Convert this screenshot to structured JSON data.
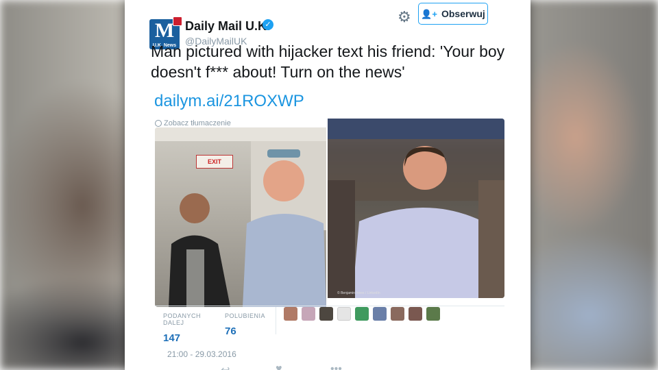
{
  "tweet": {
    "author_name": "Daily Mail U.K.",
    "author_handle": "@DailyMailUK",
    "avatar_letter": "M",
    "avatar_caption": "U.K. News",
    "follow_label": "Obserwuj",
    "text": "Man pictured with hijacker text his friend: 'Your boy doesn't f*** about! Turn on the news'",
    "link": "dailym.ai/21ROXWP",
    "translate_label": "Zobacz tłumaczenie",
    "photo_exit_sign": "EXIT",
    "photo_credit": "© Benjamin Innes / LinkedIn",
    "stats": {
      "retweets_label": "PODANYCH DALEJ",
      "retweets_count": "147",
      "likes_label": "POLUBIENIA",
      "likes_count": "76"
    },
    "timestamp": "21:00 - 29.03.2016"
  },
  "colors": {
    "accent": "#1da1f2",
    "link": "#1b95e0",
    "brand": "#1a5f9e",
    "card_bg": "#ffffff"
  },
  "icons": {
    "settings": "gear-icon",
    "follow": "person-plus-icon",
    "verified": "verified-check-icon",
    "translate": "globe-icon"
  }
}
